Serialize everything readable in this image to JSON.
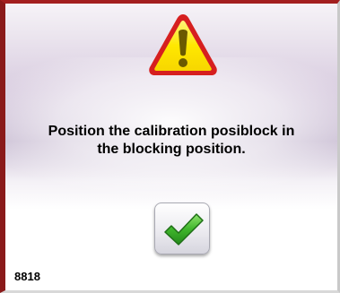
{
  "dialog": {
    "message_line1": "Position the calibration posiblock in",
    "message_line2": "the blocking position.",
    "code": "8818",
    "icons": {
      "warning": "warning-triangle-icon",
      "confirm": "check-icon"
    },
    "colors": {
      "warning_fill": "#ffe800",
      "warning_border": "#d61f1f",
      "check": "#3fb52c",
      "frame_accent": "#a31f1f"
    }
  }
}
